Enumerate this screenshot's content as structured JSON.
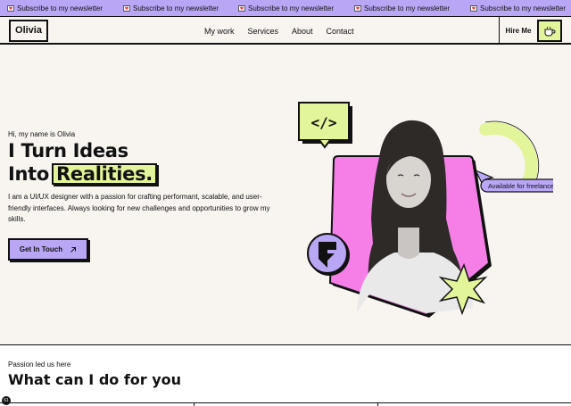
{
  "marquee": {
    "items": [
      "Subscribe to my newsletter",
      "Subscribe to my newsletter",
      "Subscribe to my newsletter",
      "Subscribe to my newsletter",
      "Subscribe to my newsletter"
    ],
    "icon": "heart-envelope-icon"
  },
  "header": {
    "logo": "Olivia",
    "nav": [
      "My work",
      "Services",
      "About",
      "Contact"
    ],
    "hire_label": "Hire Me",
    "cup_icon": "coffee-cup-icon"
  },
  "hero": {
    "greeting": "Hi, my name is Olivia",
    "headline_line1": "I Turn Ideas",
    "headline_line2_prefix": "Into",
    "headline_highlight": "Realities.",
    "description": "I am a UI/UX designer with a passion for crafting performant, scalable, and user-friendly interfaces. Always looking for new challenges and opportunities to grow my skills.",
    "cta_label": "Get In Touch",
    "code_badge": "</>",
    "availability": "Available for freelance"
  },
  "services": {
    "eyebrow": "Passion led us here",
    "title": "What can I do for you"
  },
  "colors": {
    "purple": "#b9a7f5",
    "lime": "#e3f59a",
    "pink": "#f57fe6",
    "background": "#f8f5f1"
  },
  "corner_badge": "61"
}
